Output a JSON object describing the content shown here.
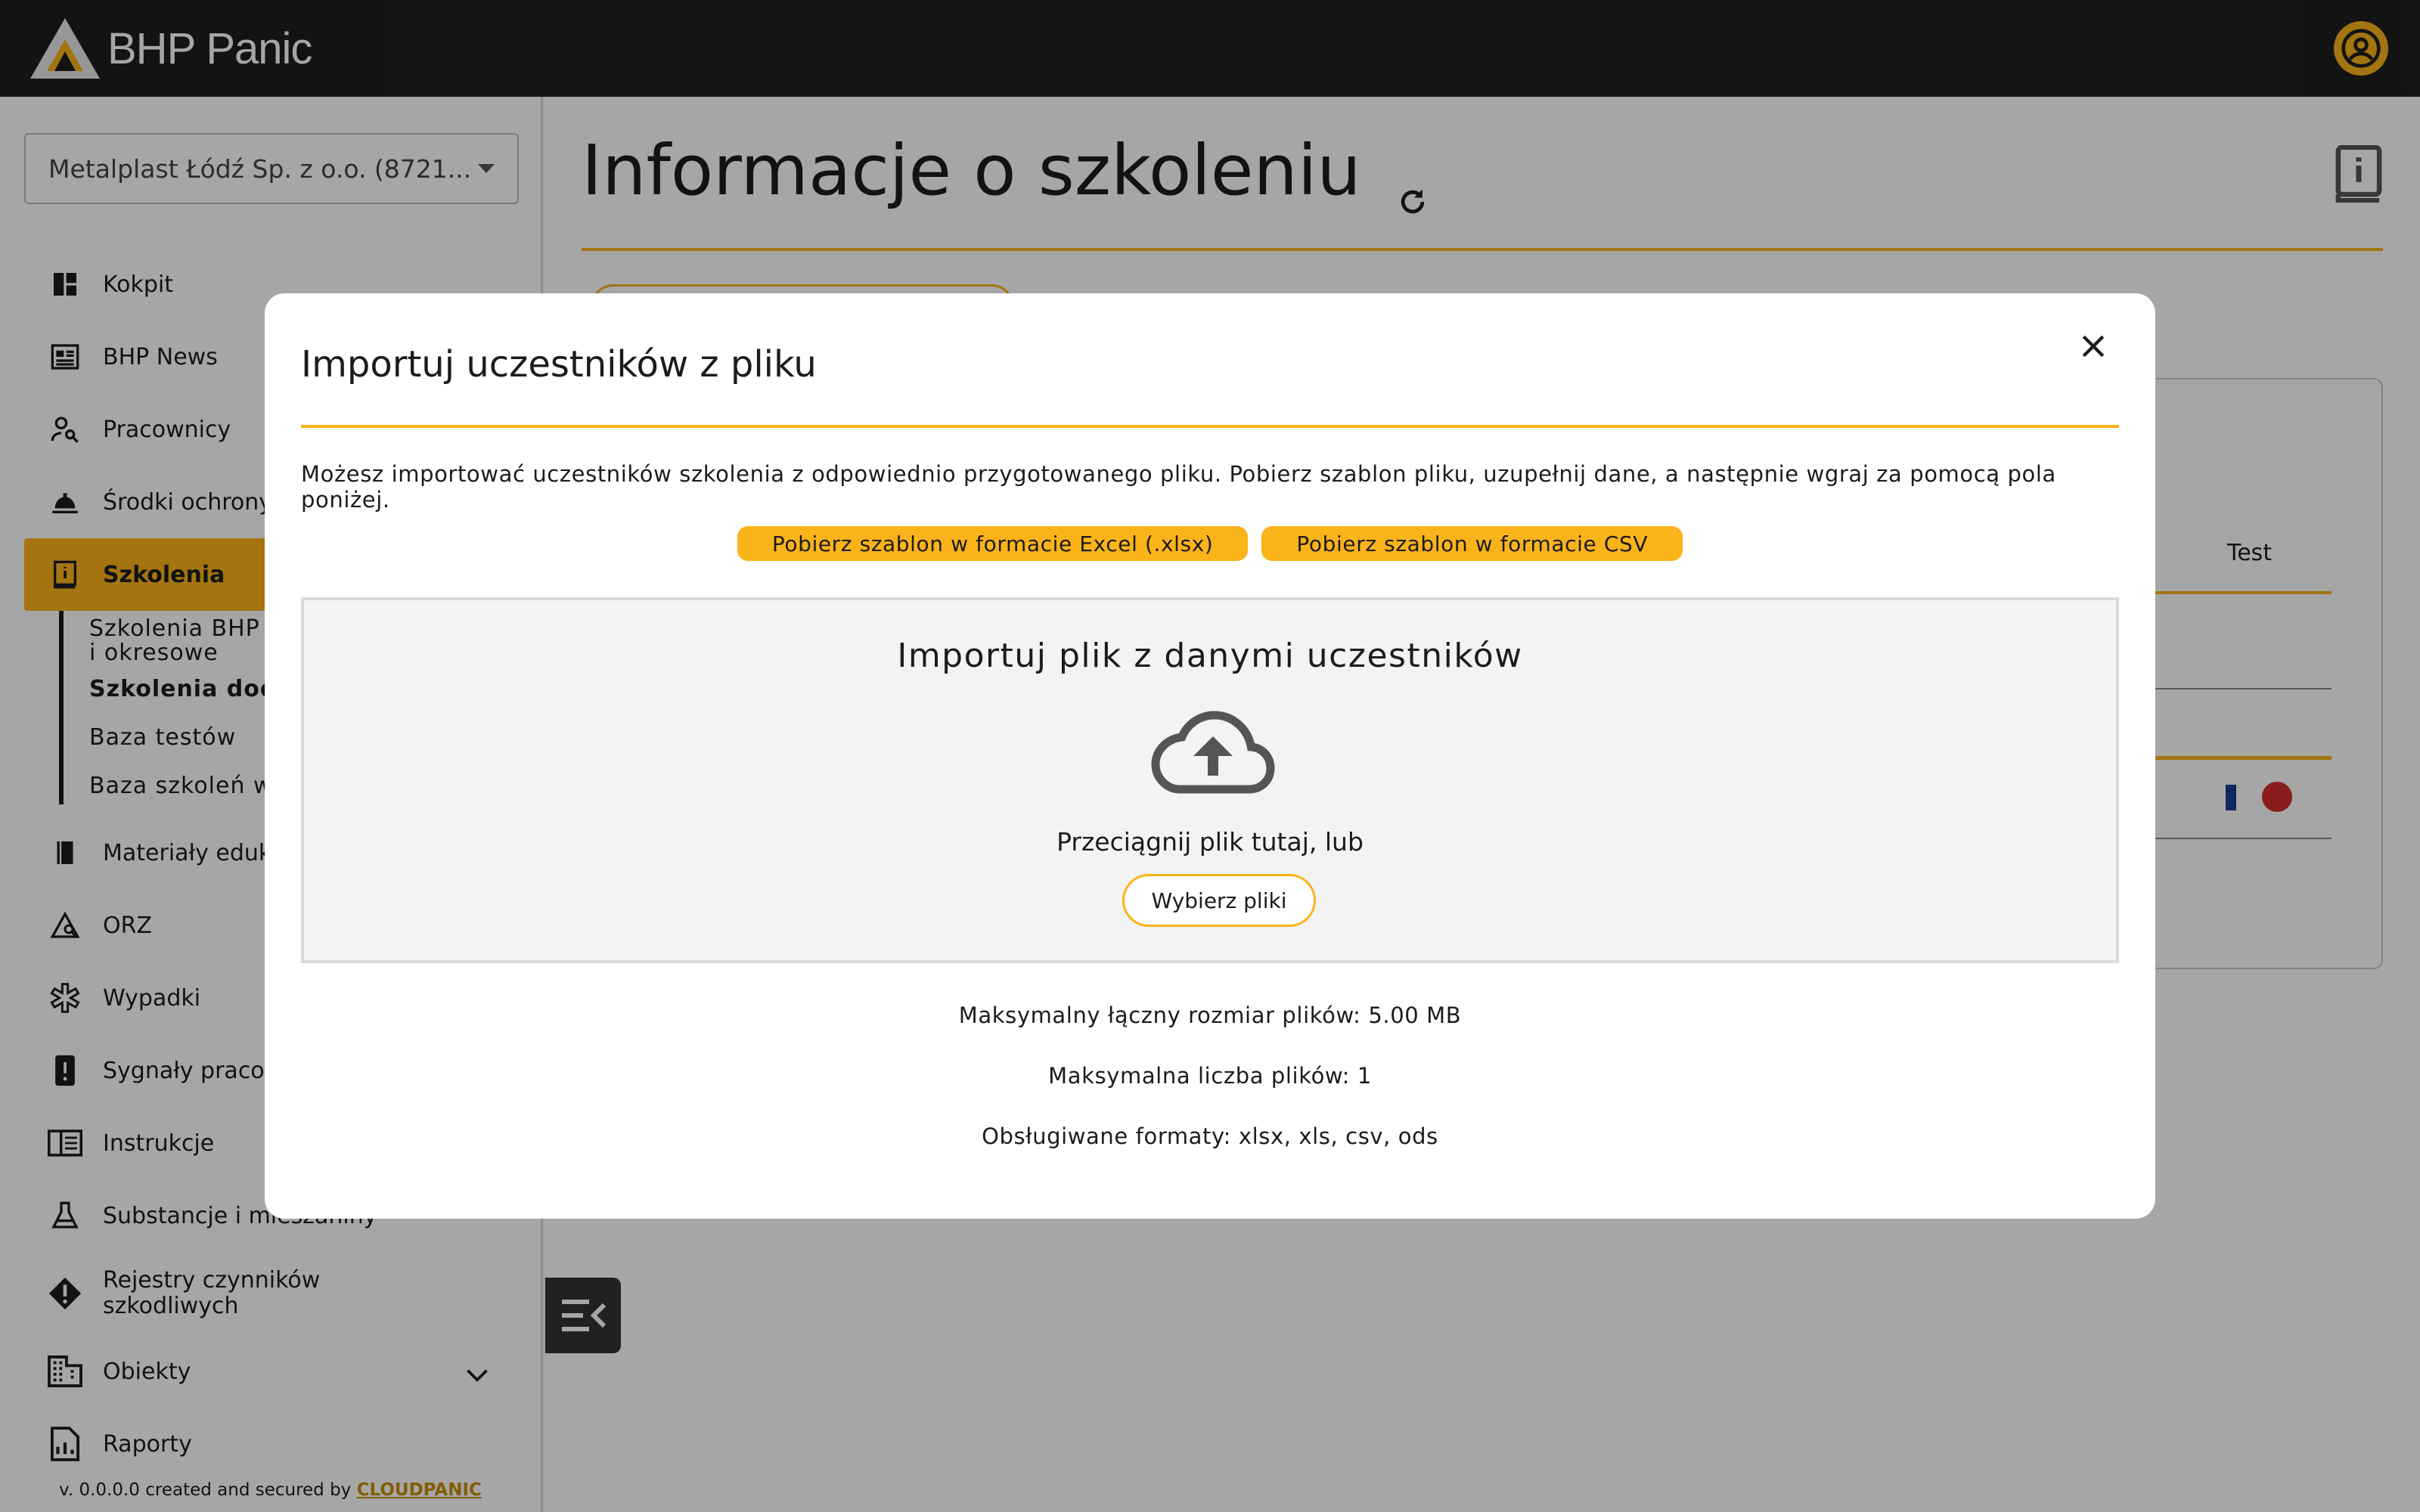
{
  "brand": {
    "name": "BHP Panic",
    "accent": "#fbb31a"
  },
  "sidebar": {
    "company_select": "Metalplast Łódź Sp. z o.o. (8721...",
    "items": [
      {
        "label": "Kokpit",
        "icon": "dashboard-icon"
      },
      {
        "label": "BHP News",
        "icon": "newspaper-icon"
      },
      {
        "label": "Pracownicy",
        "icon": "person-search-icon"
      },
      {
        "label": "Środki ochrony",
        "icon": "helmet-icon"
      },
      {
        "label": "Szkolenia",
        "icon": "training-book-icon"
      },
      {
        "label": "Materiały eduka",
        "icon": "book-icon"
      },
      {
        "label": "ORZ",
        "icon": "risk-warning-icon"
      },
      {
        "label": "Wypadki",
        "icon": "medical-star-icon"
      },
      {
        "label": "Sygnały pracow",
        "icon": "alert-phone-icon"
      },
      {
        "label": "Instrukcje",
        "icon": "instructions-icon"
      },
      {
        "label": "Substancje i mieszaniny",
        "icon": "flask-icon"
      },
      {
        "label": "Rejestry czynników szkodliwych",
        "icon": "warning-diamond-icon"
      },
      {
        "label": "Obiekty",
        "icon": "building-icon"
      },
      {
        "label": "Raporty",
        "icon": "report-icon"
      }
    ],
    "subitems": [
      {
        "label": "Szkolenia BHP w"
      },
      {
        "label": "i okresowe"
      },
      {
        "label": "Szkolenia doda"
      },
      {
        "label": "Baza testów"
      },
      {
        "label": "Baza szkoleń w"
      }
    ],
    "footer_prefix": "v. 0.0.0.0 created and secured by",
    "footer_brand": "CLOUDPANIC"
  },
  "main": {
    "title": "Informacje o szkoleniu",
    "card_text": "Test"
  },
  "modal": {
    "title": "Importuj uczestników z pliku",
    "description": "Możesz importować uczestników szkolenia z odpowiednio przygotowanego pliku. Pobierz szablon pliku, uzupełnij dane, a następnie wgraj za pomocą pola poniżej.",
    "btn_excel": "Pobierz szablon w formacie Excel (.xlsx)",
    "btn_csv": "Pobierz szablon w formacie CSV",
    "dropzone_title": "Importuj plik z danymi uczestników",
    "dropzone_text": "Przeciągnij plik tutaj, lub",
    "choose_files": "Wybierz pliki",
    "max_size": "Maksymalny łączny rozmiar plików: 5.00 MB",
    "max_count": "Maksymalna liczba plików: 1",
    "formats": "Obsługiwane formaty: xlsx, xls, csv, ods"
  }
}
